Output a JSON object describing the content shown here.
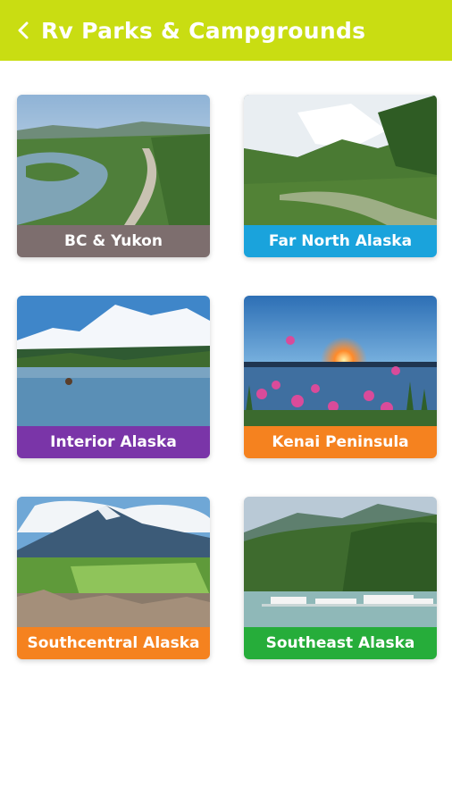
{
  "header": {
    "title": "Rv Parks & Campgrounds",
    "back_icon": "chevron-left-icon",
    "background": "#c9dd12"
  },
  "regions": [
    {
      "label": "BC & Yukon",
      "color": "#7d6e6e"
    },
    {
      "label": "Far North Alaska",
      "color": "#1aa3dc"
    },
    {
      "label": "Interior Alaska",
      "color": "#7a35a8"
    },
    {
      "label": "Kenai Peninsula",
      "color": "#f5821f"
    },
    {
      "label": "Southcentral Alaska",
      "color": "#f5821f"
    },
    {
      "label": "Southeast Alaska",
      "color": "#26ad3a"
    }
  ]
}
